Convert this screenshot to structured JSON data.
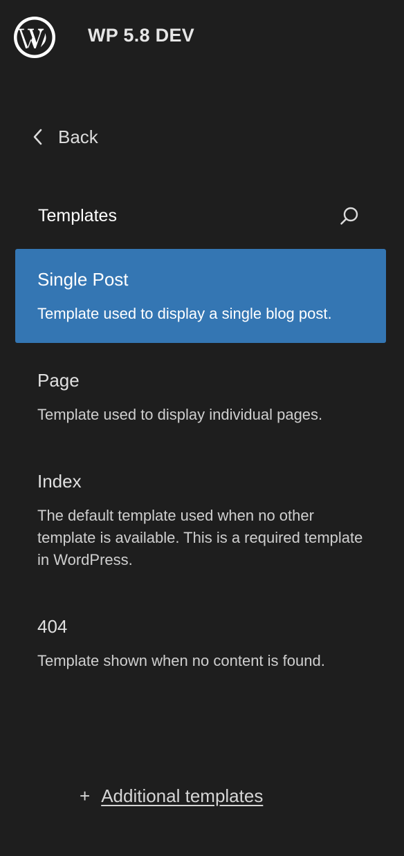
{
  "header": {
    "site_title": "WP 5.8 DEV",
    "logo_icon": "wordpress-logo-icon"
  },
  "nav": {
    "back_label": "Back",
    "back_icon": "chevron-left-icon"
  },
  "section": {
    "title": "Templates",
    "search_icon": "search-icon"
  },
  "templates": [
    {
      "title": "Single Post",
      "description": "Template used to display a single blog post.",
      "active": true
    },
    {
      "title": "Page",
      "description": "Template used to display individual pages.",
      "active": false
    },
    {
      "title": "Index",
      "description": "The default template used when no other template is available. This is a required template in WordPress.",
      "active": false
    },
    {
      "title": "404",
      "description": "Template shown when no content is found.",
      "active": false
    }
  ],
  "footer": {
    "add_icon": "plus-icon",
    "add_label": "Additional templates"
  },
  "colors": {
    "background": "#1e1e1e",
    "accent": "#3476b3",
    "text": "#e0e0e0"
  }
}
